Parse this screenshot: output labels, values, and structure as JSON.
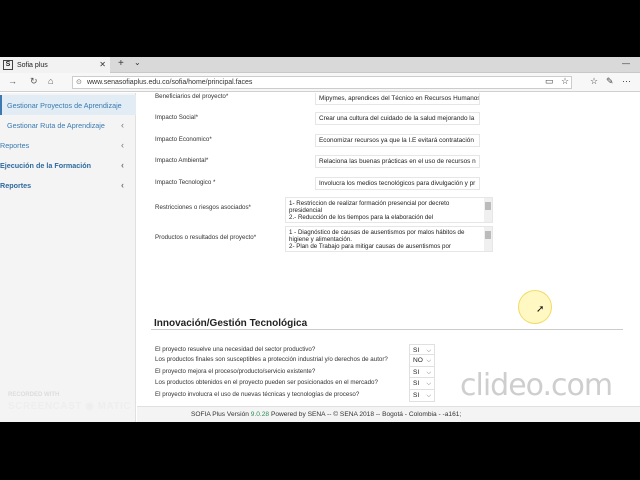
{
  "browser": {
    "tab_icon": "S",
    "tab_title": "Sofia plus",
    "tab_close": "✕",
    "new_tab": "+",
    "tab_dropdown": "⌄",
    "minimize": "—",
    "url": "www.senasofiaplus.edu.co/sofia/home/principal.faces"
  },
  "sidebar": {
    "items": [
      {
        "label": "Gestionar Proyectos de Aprendizaje",
        "chev": ""
      },
      {
        "label": "Gestionar Ruta de Aprendizaje",
        "chev": "‹"
      },
      {
        "label": "Reportes",
        "chev": "‹"
      },
      {
        "label": "Ejecución de la Formación",
        "chev": "‹"
      },
      {
        "label": "Reportes",
        "chev": "‹"
      }
    ]
  },
  "form": {
    "fields": [
      {
        "label": "Beneficiarios del proyecto*",
        "value": "Mipymes, aprendices del Técnico en Recursos Humanos"
      },
      {
        "label": "Impacto Social*",
        "value": "Crear una cultura del cuidado de la salud mejorando la"
      },
      {
        "label": "Impacto Economico*",
        "value": "Economizar recursos ya que la I.E evitará contratación"
      },
      {
        "label": "Impacto Ambiental*",
        "value": "Relaciona las buenas prácticas en el uso de recursos n"
      },
      {
        "label": "Impacto Tecnologico *",
        "value": "Involucra los medios tecnológicos para divulgación y pr"
      }
    ],
    "areas": [
      {
        "label": "Restricciones o riesgos asociados*",
        "value": "1- Restriccion de realizar formación presencial por decreto presidencial\n2.- Reducción de los tiempos para la elaboración del"
      },
      {
        "label": "Productos o resultados del proyecto*",
        "value": "1 - Diagnóstico de causas de ausentismos por malos hábitos de higiene y alimentación.\n2- Plan de Trabajo para mitigar causas de ausentismos por"
      }
    ]
  },
  "innovation": {
    "title": "Innovación/Gestión Tecnológica",
    "questions": [
      {
        "label": "El proyecto resuelve una necesidad del sector productivo?",
        "value": "SI"
      },
      {
        "label": "El proyecto mejora el proceso/producto/servicio existente?",
        "value": "SI"
      },
      {
        "label": "El proyecto involucra el uso de nuevas técnicas y tecnologías de proceso?",
        "value": "SI"
      },
      {
        "label": "Los productos finales son susceptibles a protección industrial y/o derechos de autor?",
        "value": "NO"
      },
      {
        "label": "Los productos obtenidos en el proyecto pueden ser posicionados en el mercado?",
        "value": "SI"
      }
    ]
  },
  "footer": {
    "prefix": "SOFIA Plus Versión",
    "version": "9.0.28",
    "suffix": "Powered by SENA -- © SENA 2018 -- Bogotá - Colombia - -a161;"
  },
  "watermarks": {
    "clideo": "clideo.com",
    "recorded_with": "RECORDED WITH",
    "screencast": "SCREENCAST ◉ MATIC"
  },
  "icons": [
    "back-icon",
    "forward-icon",
    "home-icon",
    "lock-icon",
    "reader-view-icon",
    "star-icon",
    "favorites-icon",
    "share-icon",
    "more-icon"
  ]
}
